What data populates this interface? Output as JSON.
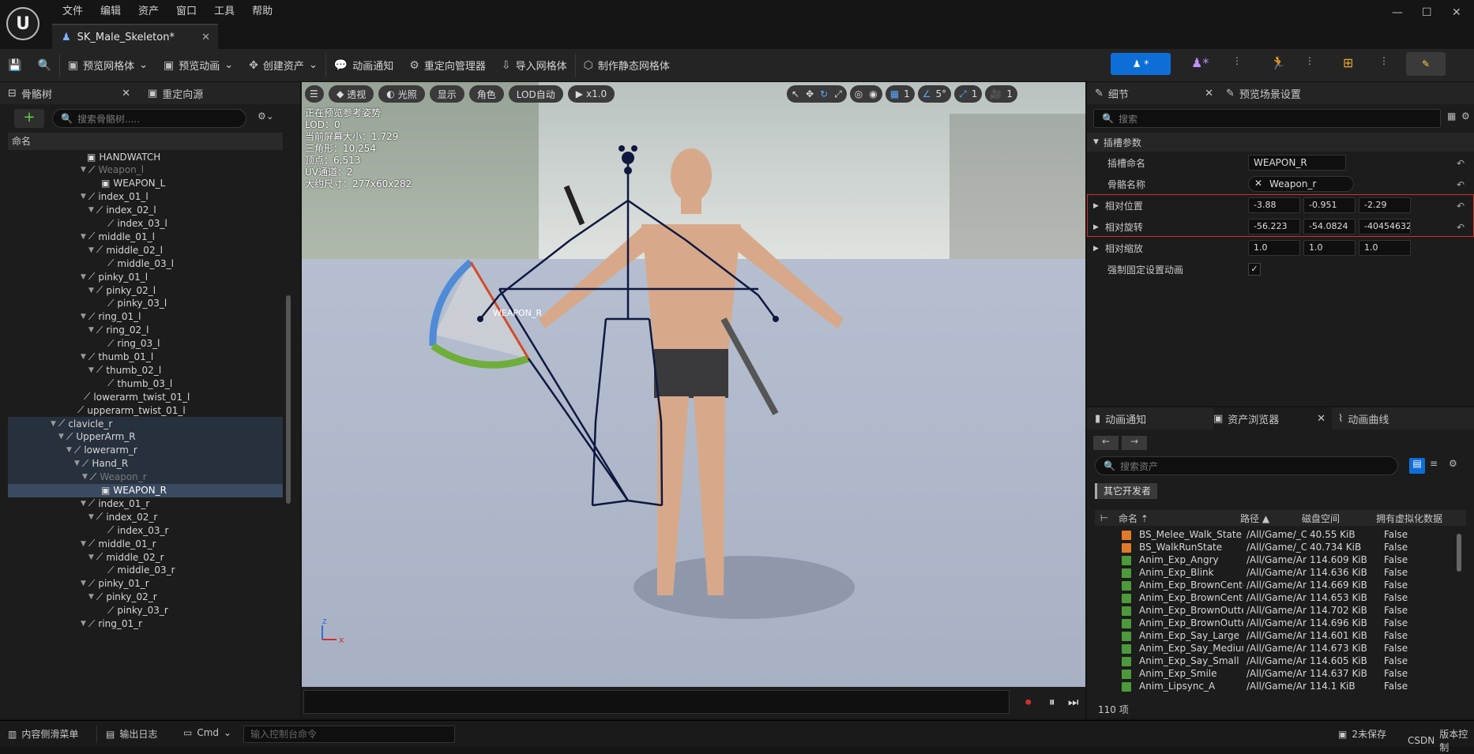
{
  "menu": [
    "文件",
    "编辑",
    "资产",
    "窗口",
    "工具",
    "帮助"
  ],
  "doc_tab": {
    "label": "SK_Male_Skeleton*"
  },
  "toolbar": {
    "preview_mesh": "预览网格体",
    "preview_anim": "预览动画",
    "create_asset": "创建资产",
    "anim_notify": "动画通知",
    "retarget_mgr": "重定向管理器",
    "import_mesh": "导入网格体",
    "make_static": "制作静态网格体"
  },
  "skeleton_panel": {
    "tab_tree": "骨骼树",
    "tab_retarget": "重定向源",
    "search_placeholder": "搜索骨骼树.....",
    "col_name": "命名",
    "rows": [
      {
        "label": "HANDWATCH",
        "indent": 110,
        "type": "socket"
      },
      {
        "label": "Weapon_l",
        "indent": 102,
        "type": "bone-dim",
        "arrow": true
      },
      {
        "label": "WEAPON_L",
        "indent": 128,
        "type": "socket"
      },
      {
        "label": "index_01_l",
        "indent": 102,
        "type": "bone",
        "arrow": true
      },
      {
        "label": "index_02_l",
        "indent": 112,
        "type": "bone",
        "arrow": true
      },
      {
        "label": "index_03_l",
        "indent": 136,
        "type": "bone"
      },
      {
        "label": "middle_01_l",
        "indent": 102,
        "type": "bone",
        "arrow": true
      },
      {
        "label": "middle_02_l",
        "indent": 112,
        "type": "bone",
        "arrow": true
      },
      {
        "label": "middle_03_l",
        "indent": 136,
        "type": "bone"
      },
      {
        "label": "pinky_01_l",
        "indent": 102,
        "type": "bone",
        "arrow": true
      },
      {
        "label": "pinky_02_l",
        "indent": 112,
        "type": "bone",
        "arrow": true
      },
      {
        "label": "pinky_03_l",
        "indent": 136,
        "type": "bone"
      },
      {
        "label": "ring_01_l",
        "indent": 102,
        "type": "bone",
        "arrow": true
      },
      {
        "label": "ring_02_l",
        "indent": 112,
        "type": "bone",
        "arrow": true
      },
      {
        "label": "ring_03_l",
        "indent": 136,
        "type": "bone"
      },
      {
        "label": "thumb_01_l",
        "indent": 102,
        "type": "bone",
        "arrow": true
      },
      {
        "label": "thumb_02_l",
        "indent": 112,
        "type": "bone",
        "arrow": true
      },
      {
        "label": "thumb_03_l",
        "indent": 136,
        "type": "bone"
      },
      {
        "label": "lowerarm_twist_01_l",
        "indent": 106,
        "type": "bone"
      },
      {
        "label": "upperarm_twist_01_l",
        "indent": 98,
        "type": "bone"
      },
      {
        "label": "clavicle_r",
        "indent": 64,
        "type": "bone",
        "arrow": true,
        "sel": true
      },
      {
        "label": "UpperArm_R",
        "indent": 74,
        "type": "bone",
        "arrow": true,
        "sel": true
      },
      {
        "label": "lowerarm_r",
        "indent": 84,
        "type": "bone",
        "arrow": true,
        "sel": true
      },
      {
        "label": "Hand_R",
        "indent": 94,
        "type": "bone",
        "arrow": true,
        "sel": true
      },
      {
        "label": "Weapon_r",
        "indent": 104,
        "type": "bone-dim",
        "arrow": true,
        "sel": true
      },
      {
        "label": "WEAPON_R",
        "indent": 128,
        "type": "socket",
        "focus": true
      },
      {
        "label": "index_01_r",
        "indent": 102,
        "type": "bone",
        "arrow": true
      },
      {
        "label": "index_02_r",
        "indent": 112,
        "type": "bone",
        "arrow": true
      },
      {
        "label": "index_03_r",
        "indent": 136,
        "type": "bone"
      },
      {
        "label": "middle_01_r",
        "indent": 102,
        "type": "bone",
        "arrow": true
      },
      {
        "label": "middle_02_r",
        "indent": 112,
        "type": "bone",
        "arrow": true
      },
      {
        "label": "middle_03_r",
        "indent": 136,
        "type": "bone"
      },
      {
        "label": "pinky_01_r",
        "indent": 102,
        "type": "bone",
        "arrow": true
      },
      {
        "label": "pinky_02_r",
        "indent": 112,
        "type": "bone",
        "arrow": true
      },
      {
        "label": "pinky_03_r",
        "indent": 136,
        "type": "bone"
      },
      {
        "label": "ring_01_r",
        "indent": 102,
        "type": "bone",
        "arrow": true
      }
    ]
  },
  "viewport": {
    "perspective": "透视",
    "lit": "光照",
    "show": "显示",
    "character": "角色",
    "lod": "LOD自动",
    "speed": "x1.0",
    "grid_val": "1",
    "angle_val": "5°",
    "scale_val": "1",
    "cam_val": "1",
    "stats": [
      "正在预览参考姿势",
      "LOD：0",
      "当前屏幕大小：1.729",
      "三角形：10,254",
      "顶点：6,513",
      "UV通道：2",
      "大约尺寸：277x60x282"
    ],
    "socket_label": "WEAPON_R",
    "axis_z": "z",
    "axis_x": "x"
  },
  "details": {
    "tab_details": "细节",
    "tab_preview": "预览场景设置",
    "search_placeholder": "搜索",
    "section": "插槽参数",
    "socket_name_label": "插槽命名",
    "socket_name": "WEAPON_R",
    "bone_name_label": "骨骼名称",
    "bone_name": "Weapon_r",
    "loc_label": "相对位置",
    "loc": [
      "-3.88",
      "-0.951",
      "-2.29"
    ],
    "rot_label": "相对旋转",
    "rot": [
      "-56.223",
      "-54.0824",
      "-40454632.0"
    ],
    "scale_label": "相对缩放",
    "scale": [
      "1.0",
      "1.0",
      "1.0"
    ],
    "force_label": "强制固定设置动画",
    "highlight_color": "#d0302c"
  },
  "assets": {
    "tab_notify": "动画通知",
    "tab_browser": "资产浏览器",
    "tab_curves": "动画曲线",
    "search_placeholder": "搜索资产",
    "filter_chip": "其它开发者",
    "cols": [
      "命名",
      "路径",
      "磁盘空间",
      "拥有虚拟化数据"
    ],
    "rows": [
      {
        "name": "BS_Melee_Walk_State",
        "path": "/All/Game/_C",
        "size": "40.55 KiB",
        "v": "False",
        "color": "#e07a2a"
      },
      {
        "name": "BS_WalkRunState",
        "path": "/All/Game/_C",
        "size": "40.734 KiB",
        "v": "False",
        "color": "#e07a2a"
      },
      {
        "name": "Anim_Exp_Angry",
        "path": "/All/Game/Ar",
        "size": "114.609 KiB",
        "v": "False",
        "color": "#4c9a3a"
      },
      {
        "name": "Anim_Exp_Blink",
        "path": "/All/Game/Ar",
        "size": "114.636 KiB",
        "v": "False",
        "color": "#4c9a3a"
      },
      {
        "name": "Anim_Exp_BrownCente",
        "path": "/All/Game/Ar",
        "size": "114.669 KiB",
        "v": "False",
        "color": "#4c9a3a"
      },
      {
        "name": "Anim_Exp_BrownCente",
        "path": "/All/Game/Ar",
        "size": "114.653 KiB",
        "v": "False",
        "color": "#4c9a3a"
      },
      {
        "name": "Anim_Exp_BrownOutte",
        "path": "/All/Game/Ar",
        "size": "114.702 KiB",
        "v": "False",
        "color": "#4c9a3a"
      },
      {
        "name": "Anim_Exp_BrownOutte",
        "path": "/All/Game/Ar",
        "size": "114.696 KiB",
        "v": "False",
        "color": "#4c9a3a"
      },
      {
        "name": "Anim_Exp_Say_Large",
        "path": "/All/Game/Ar",
        "size": "114.601 KiB",
        "v": "False",
        "color": "#4c9a3a"
      },
      {
        "name": "Anim_Exp_Say_Mediur",
        "path": "/All/Game/Ar",
        "size": "114.673 KiB",
        "v": "False",
        "color": "#4c9a3a"
      },
      {
        "name": "Anim_Exp_Say_Small",
        "path": "/All/Game/Ar",
        "size": "114.605 KiB",
        "v": "False",
        "color": "#4c9a3a"
      },
      {
        "name": "Anim_Exp_Smile",
        "path": "/All/Game/Ar",
        "size": "114.637 KiB",
        "v": "False",
        "color": "#4c9a3a"
      },
      {
        "name": "Anim_Lipsync_A",
        "path": "/All/Game/Ar",
        "size": "114.1 KiB",
        "v": "False",
        "color": "#4c9a3a"
      }
    ],
    "count": "110 项"
  },
  "status": {
    "drawer": "内容侧滑菜单",
    "log": "输出日志",
    "cmd": "Cmd",
    "console_placeholder": "输入控制台命令",
    "unsaved": "2未保存",
    "csdn": "CSDN",
    "source": "版本控制"
  }
}
